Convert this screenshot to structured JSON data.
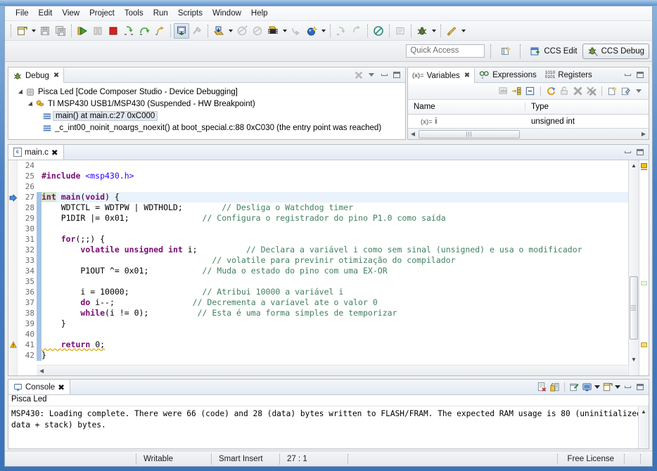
{
  "menu": {
    "items": [
      "File",
      "Edit",
      "View",
      "Project",
      "Tools",
      "Run",
      "Scripts",
      "Window",
      "Help"
    ]
  },
  "toolbar": {
    "groups": [
      {
        "buttons": [
          {
            "name": "new-button",
            "icon": "new-file-icon",
            "enabled": true,
            "dropdown": true
          },
          {
            "name": "save-button",
            "icon": "save-icon",
            "enabled": false,
            "dropdown": false
          },
          {
            "name": "save-all-button",
            "icon": "save-all-icon",
            "enabled": false,
            "dropdown": false
          }
        ]
      },
      {
        "buttons": [
          {
            "name": "resume-button",
            "icon": "resume-icon",
            "enabled": true,
            "dropdown": false
          },
          {
            "name": "suspend-button",
            "icon": "suspend-icon",
            "enabled": false,
            "dropdown": false
          },
          {
            "name": "terminate-button",
            "icon": "terminate-icon",
            "enabled": true,
            "dropdown": false
          },
          {
            "name": "step-into-button",
            "icon": "step-into-icon",
            "enabled": true,
            "dropdown": false
          },
          {
            "name": "step-over-button",
            "icon": "step-over-icon",
            "enabled": true,
            "dropdown": false
          },
          {
            "name": "step-return-button",
            "icon": "step-return-icon",
            "enabled": false,
            "dropdown": false
          }
        ]
      },
      {
        "buttons": [
          {
            "name": "restart-button",
            "icon": "restart-icon",
            "enabled": true,
            "pressed": true,
            "dropdown": false
          },
          {
            "name": "assembly-step-button",
            "icon": "assembly-step-icon",
            "enabled": false,
            "dropdown": false
          }
        ]
      },
      {
        "buttons": [
          {
            "name": "load-program-button",
            "icon": "load-program-icon",
            "enabled": true,
            "dropdown": true
          },
          {
            "name": "connect-target-button",
            "icon": "connect-target-icon",
            "enabled": false,
            "dropdown": false
          },
          {
            "name": "disconnect-target-button",
            "icon": "disconnect-target-icon",
            "enabled": false,
            "dropdown": false
          },
          {
            "name": "debug-configurations-button",
            "icon": "chip-icon",
            "enabled": true,
            "dropdown": true
          },
          {
            "name": "profile-button",
            "icon": "profile-icon",
            "enabled": false,
            "dropdown": false
          },
          {
            "name": "new-target-config-button",
            "icon": "target-config-icon",
            "enabled": true,
            "dropdown": true
          }
        ]
      },
      {
        "buttons": [
          {
            "name": "step-forward-button",
            "icon": "step-forward-icon",
            "enabled": false,
            "dropdown": false
          },
          {
            "name": "step-back-button",
            "icon": "step-back-icon",
            "enabled": false,
            "dropdown": false
          }
        ]
      },
      {
        "buttons": [
          {
            "name": "no-entry-button",
            "icon": "no-entry-icon",
            "enabled": true,
            "dropdown": false
          }
        ]
      },
      {
        "buttons": [
          {
            "name": "console-window-button",
            "icon": "console-window-icon",
            "enabled": false,
            "dropdown": false
          }
        ]
      },
      {
        "buttons": [
          {
            "name": "debug-bug-button",
            "icon": "bug-icon",
            "enabled": true,
            "dropdown": true
          }
        ]
      },
      {
        "buttons": [
          {
            "name": "run-button",
            "icon": "run-pencil-icon",
            "enabled": true,
            "dropdown": true
          }
        ]
      }
    ]
  },
  "perspective": {
    "quick_access_placeholder": "Quick Access",
    "new_perspective_label": "",
    "buttons": [
      {
        "name": "ccs-edit-perspective",
        "label": "CCS Edit",
        "active": false,
        "icon": "ccs-edit-icon"
      },
      {
        "name": "ccs-debug-perspective",
        "label": "CCS Debug",
        "active": true,
        "icon": "ccs-debug-icon"
      }
    ]
  },
  "debug_view": {
    "tab_label": "Debug",
    "tab_icon": "debug-bug-icon",
    "tree": [
      {
        "level": 0,
        "icon": "launch-icon",
        "label": "Pisca Led [Code Composer Studio - Device Debugging]",
        "expanded": true,
        "selected": false
      },
      {
        "level": 1,
        "icon": "thread-icon",
        "label": "TI MSP430 USB1/MSP430 (Suspended - HW Breakpoint)",
        "expanded": true,
        "selected": false
      },
      {
        "level": 2,
        "icon": "stackframe-icon",
        "label": "main() at main.c:27 0xC000",
        "expanded": false,
        "selected": true
      },
      {
        "level": 2,
        "icon": "stackframe-icon",
        "label": "_c_int00_noinit_noargs_noexit() at boot_special.c:88 0xC030  (the entry point was reached)",
        "expanded": false,
        "selected": false
      }
    ]
  },
  "variables_view": {
    "tabs": [
      {
        "name": "tab-variables",
        "label": "Variables",
        "icon": "variables-icon",
        "active": true
      },
      {
        "name": "tab-expressions",
        "label": "Expressions",
        "icon": "expressions-icon",
        "active": false
      },
      {
        "name": "tab-registers",
        "label": "Registers",
        "icon": "registers-icon",
        "active": false
      }
    ],
    "columns": [
      "Name",
      "Type"
    ],
    "rows": [
      {
        "name": "i",
        "type": "unsigned int",
        "icon": "variable-icon"
      }
    ],
    "toolbar_icons": [
      "show-type-names-icon",
      "show-logical-structure-icon",
      "collapse-all-icon",
      "refresh-icon",
      "cast-to-type-icon",
      "remove-icon",
      "remove-all-icon",
      "new-variable-icon",
      "new-watch-icon",
      "view-menu-icon"
    ]
  },
  "editor": {
    "tab_label": "main.c",
    "tab_icon": "c-file-icon",
    "file_icon_letter": "c",
    "first_line_number": 24,
    "current_line": 27,
    "lines": [
      {
        "n": 24,
        "tokens": []
      },
      {
        "n": 25,
        "tokens": [
          {
            "t": "#include ",
            "c": "pp"
          },
          {
            "t": "<msp430.h>",
            "c": "hdr"
          }
        ]
      },
      {
        "n": 26,
        "tokens": []
      },
      {
        "n": 27,
        "current": true,
        "arrow": true,
        "tokens": [
          {
            "t": "int",
            "c": "kw occ"
          },
          {
            "t": " ",
            "c": "plain"
          },
          {
            "t": "main",
            "c": "kwb"
          },
          {
            "t": "(",
            "c": "plain"
          },
          {
            "t": "void",
            "c": "kw"
          },
          {
            "t": ") {",
            "c": "plain"
          }
        ]
      },
      {
        "n": 28,
        "tokens": [
          {
            "t": "    WDTCTL = WDTPW | WDTHOLD;",
            "c": "plain"
          },
          {
            "t": "        ",
            "c": "plain"
          },
          {
            "t": "// Desliga o Watchdog timer",
            "c": "cmt"
          }
        ]
      },
      {
        "n": 29,
        "tokens": [
          {
            "t": "    P1DIR |= ",
            "c": "plain"
          },
          {
            "t": "0x01",
            "c": "numv"
          },
          {
            "t": ";",
            "c": "plain"
          },
          {
            "t": "               ",
            "c": "plain"
          },
          {
            "t": "// Configura o registrador do pino P1.0 como saída",
            "c": "cmt"
          }
        ]
      },
      {
        "n": 30,
        "tokens": []
      },
      {
        "n": 31,
        "tokens": [
          {
            "t": "    ",
            "c": "plain"
          },
          {
            "t": "for",
            "c": "kw"
          },
          {
            "t": "(;;) {",
            "c": "plain"
          }
        ]
      },
      {
        "n": 32,
        "tokens": [
          {
            "t": "        ",
            "c": "plain"
          },
          {
            "t": "volatile unsigned int",
            "c": "kw"
          },
          {
            "t": " i;",
            "c": "plain"
          },
          {
            "t": "          ",
            "c": "plain"
          },
          {
            "t": "// Declara a variável i como sem sinal (unsigned) e usa o modificador",
            "c": "cmt"
          }
        ]
      },
      {
        "n": 33,
        "tokens": [
          {
            "t": "                                   ",
            "c": "plain"
          },
          {
            "t": "// volatile para previnir otimização do compilador",
            "c": "cmt"
          }
        ]
      },
      {
        "n": 34,
        "tokens": [
          {
            "t": "        P1OUT ^= ",
            "c": "plain"
          },
          {
            "t": "0x01",
            "c": "numv"
          },
          {
            "t": ";",
            "c": "plain"
          },
          {
            "t": "           ",
            "c": "plain"
          },
          {
            "t": "// Muda o estado do pino com uma EX-OR",
            "c": "cmt"
          }
        ]
      },
      {
        "n": 35,
        "tokens": []
      },
      {
        "n": 36,
        "tokens": [
          {
            "t": "        i = ",
            "c": "plain"
          },
          {
            "t": "10000",
            "c": "numv"
          },
          {
            "t": ";",
            "c": "plain"
          },
          {
            "t": "               ",
            "c": "plain"
          },
          {
            "t": "// Atribui 10000 a variável i",
            "c": "cmt"
          }
        ]
      },
      {
        "n": 37,
        "tokens": [
          {
            "t": "        ",
            "c": "plain"
          },
          {
            "t": "do",
            "c": "kw"
          },
          {
            "t": " i--;",
            "c": "plain"
          },
          {
            "t": "                ",
            "c": "plain"
          },
          {
            "t": "// Decrementa a varíavel ate o valor 0",
            "c": "cmt"
          }
        ]
      },
      {
        "n": 38,
        "tokens": [
          {
            "t": "        ",
            "c": "plain"
          },
          {
            "t": "while",
            "c": "kw"
          },
          {
            "t": "(i != ",
            "c": "plain"
          },
          {
            "t": "0",
            "c": "numv"
          },
          {
            "t": ");",
            "c": "plain"
          },
          {
            "t": "          ",
            "c": "plain"
          },
          {
            "t": "// Esta é uma forma simples de temporizar",
            "c": "cmt"
          }
        ]
      },
      {
        "n": 39,
        "tokens": [
          {
            "t": "    }",
            "c": "plain"
          }
        ]
      },
      {
        "n": 40,
        "tokens": []
      },
      {
        "n": 41,
        "warning": true,
        "tokens": [
          {
            "t": "    ",
            "c": "plain"
          },
          {
            "t": "return",
            "c": "kw warn"
          },
          {
            "t": " ",
            "c": "plain warn"
          },
          {
            "t": "0",
            "c": "numv warn"
          },
          {
            "t": ";",
            "c": "plain warn"
          }
        ]
      },
      {
        "n": 42,
        "tokens": [
          {
            "t": "}",
            "c": "plain"
          }
        ]
      }
    ]
  },
  "console_view": {
    "tab_label": "Console",
    "tab_icon": "console-icon",
    "context_label": "Pisca Led",
    "output": "MSP430: Loading complete. There were 66 (code) and 28 (data) bytes written to FLASH/FRAM. The expected RAM usage is 80\n(uninitialized data + stack) bytes.",
    "toolbar_icons": [
      "clear-console-icon",
      "lock-scroll-icon",
      "pin-console-icon",
      "display-console-icon",
      "open-console-icon",
      "minimize-icon",
      "maximize-icon"
    ]
  },
  "status_bar": {
    "writable": "Writable",
    "insert_mode": "Smart Insert",
    "cursor_position": "27 : 1",
    "license": "Free License"
  },
  "colors": {
    "keyword": "#7a0874",
    "comment": "#3f7f5f",
    "header_string": "#2a00ff",
    "occurrence_highlight": "#d3e8c6",
    "current_line": "#eaf2fb",
    "accent_blue": "#3b72b9"
  }
}
